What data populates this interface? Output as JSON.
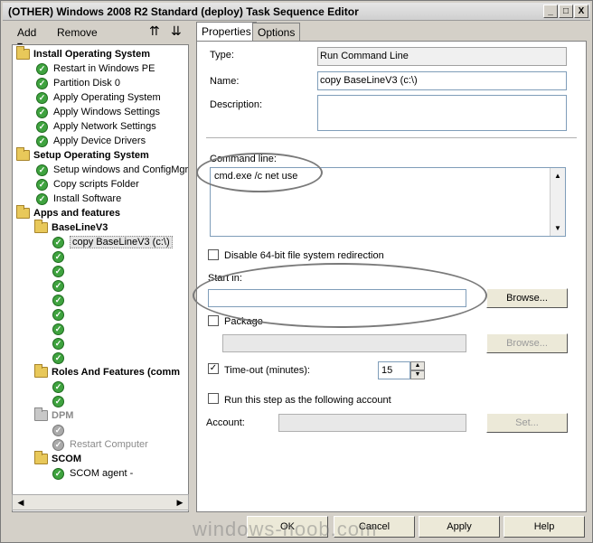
{
  "window": {
    "title": "(OTHER) Windows 2008 R2 Standard (deploy) Task Sequence Editor",
    "minimize_glyph": "_",
    "maximize_glyph": "□",
    "close_glyph": "X"
  },
  "toolbar": {
    "add_label": "Add",
    "add_arrow": "▾",
    "remove_label": "Remove",
    "up_icon_glyph": "⇈",
    "down_icon_glyph": "⇊"
  },
  "tree": {
    "items": [
      {
        "label": "Install Operating System",
        "type": "group"
      },
      {
        "label": "Restart in Windows PE",
        "type": "step"
      },
      {
        "label": "Partition Disk 0",
        "type": "step"
      },
      {
        "label": "Apply Operating System",
        "type": "step"
      },
      {
        "label": "Apply Windows Settings",
        "type": "step"
      },
      {
        "label": "Apply Network Settings",
        "type": "step"
      },
      {
        "label": "Apply Device Drivers",
        "type": "step"
      },
      {
        "label": "Setup Operating System",
        "type": "group"
      },
      {
        "label": "Setup windows and ConfigMgr",
        "type": "step"
      },
      {
        "label": "Copy scripts Folder",
        "type": "step"
      },
      {
        "label": "Install Software",
        "type": "step"
      },
      {
        "label": "Apps and features",
        "type": "group"
      },
      {
        "label": "BaseLineV3",
        "type": "subgroup"
      },
      {
        "label": "copy BaseLineV3 (c:\\)",
        "type": "selected"
      },
      {
        "label": "Roles And Features (comm",
        "type": "subgroup"
      },
      {
        "label": "DPM",
        "type": "disabled-group"
      },
      {
        "label": "Restart Computer",
        "type": "disabled-step"
      },
      {
        "label": "SCOM",
        "type": "subgroup"
      },
      {
        "label": "SCOM agent -",
        "type": "step"
      }
    ],
    "check_glyph": "✓",
    "scroll_left": "◀",
    "scroll_right": "▶"
  },
  "tabs": {
    "properties": "Properties",
    "options": "Options"
  },
  "properties": {
    "type_label": "Type:",
    "type_value": "Run Command Line",
    "name_label": "Name:",
    "name_value": "copy BaseLineV3 (c:\\)",
    "description_label": "Description:",
    "description_value": "",
    "command_line_label": "Command line:",
    "command_line_value": "cmd.exe /c net use",
    "scroll_up": "▲",
    "scroll_down": "▼",
    "disable_64bit_label": "Disable 64-bit file system redirection",
    "start_in_label": "Start in:",
    "start_in_value": "",
    "browse_label": "Browse...",
    "package_label": "Package",
    "package_value": "",
    "browse_package_label": "Browse...",
    "timeout_check": "✓",
    "timeout_label": "Time-out (minutes):",
    "timeout_value": "15",
    "spin_up": "▲",
    "spin_down": "▼",
    "run_as_label": "Run this step as the following account",
    "account_label": "Account:",
    "account_value": "",
    "set_label": "Set..."
  },
  "buttons": {
    "ok": "OK",
    "cancel": "Cancel",
    "apply": "Apply",
    "help": "Help"
  },
  "watermark": "windows-noob.com"
}
